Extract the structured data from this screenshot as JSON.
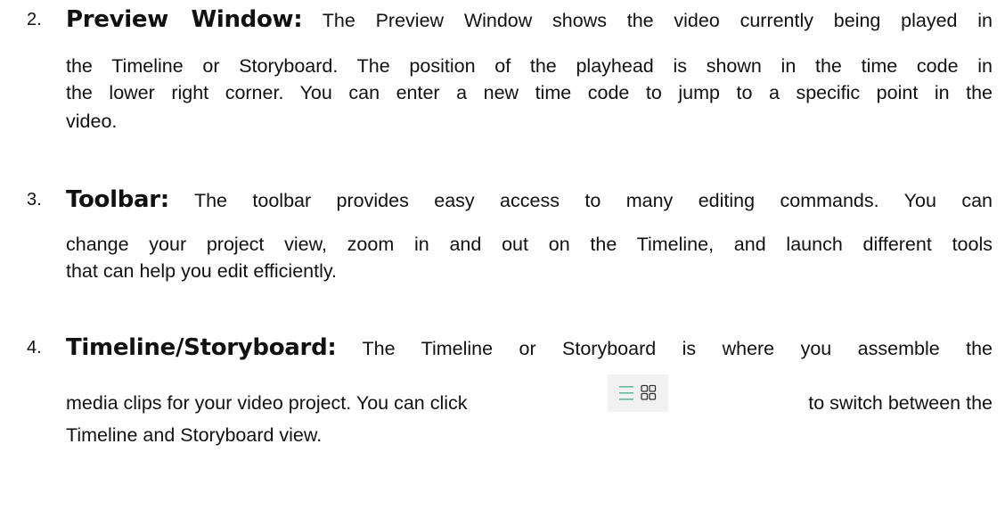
{
  "items": [
    {
      "number": "2.",
      "title": "Preview Window:",
      "lines": [
        "The Preview Window shows the video currently being played in",
        "the Timeline or Storyboard. The position of the playhead is shown in the time code in",
        "the lower right corner. You can enter a new time code to jump to a specific point in the",
        "video."
      ]
    },
    {
      "number": "3.",
      "title": "Toolbar:",
      "lines": [
        "The toolbar provides easy access to many editing commands. You can",
        "change your project view, zoom in and out on the Timeline, and launch different tools",
        "that can help you edit efficiently."
      ]
    },
    {
      "number": "4.",
      "title": "Timeline/Storyboard:",
      "lines": [
        "The Timeline or Storyboard is where you assemble the",
        "media clips for your video project. You can click",
        "to switch between the",
        "Timeline and Storyboard view."
      ],
      "icons": [
        "list-view-icon",
        "grid-view-icon"
      ]
    }
  ],
  "colors": {
    "text": "#111111",
    "icon": "#6ab8a2",
    "icon_bg": "#f1f1f1"
  }
}
